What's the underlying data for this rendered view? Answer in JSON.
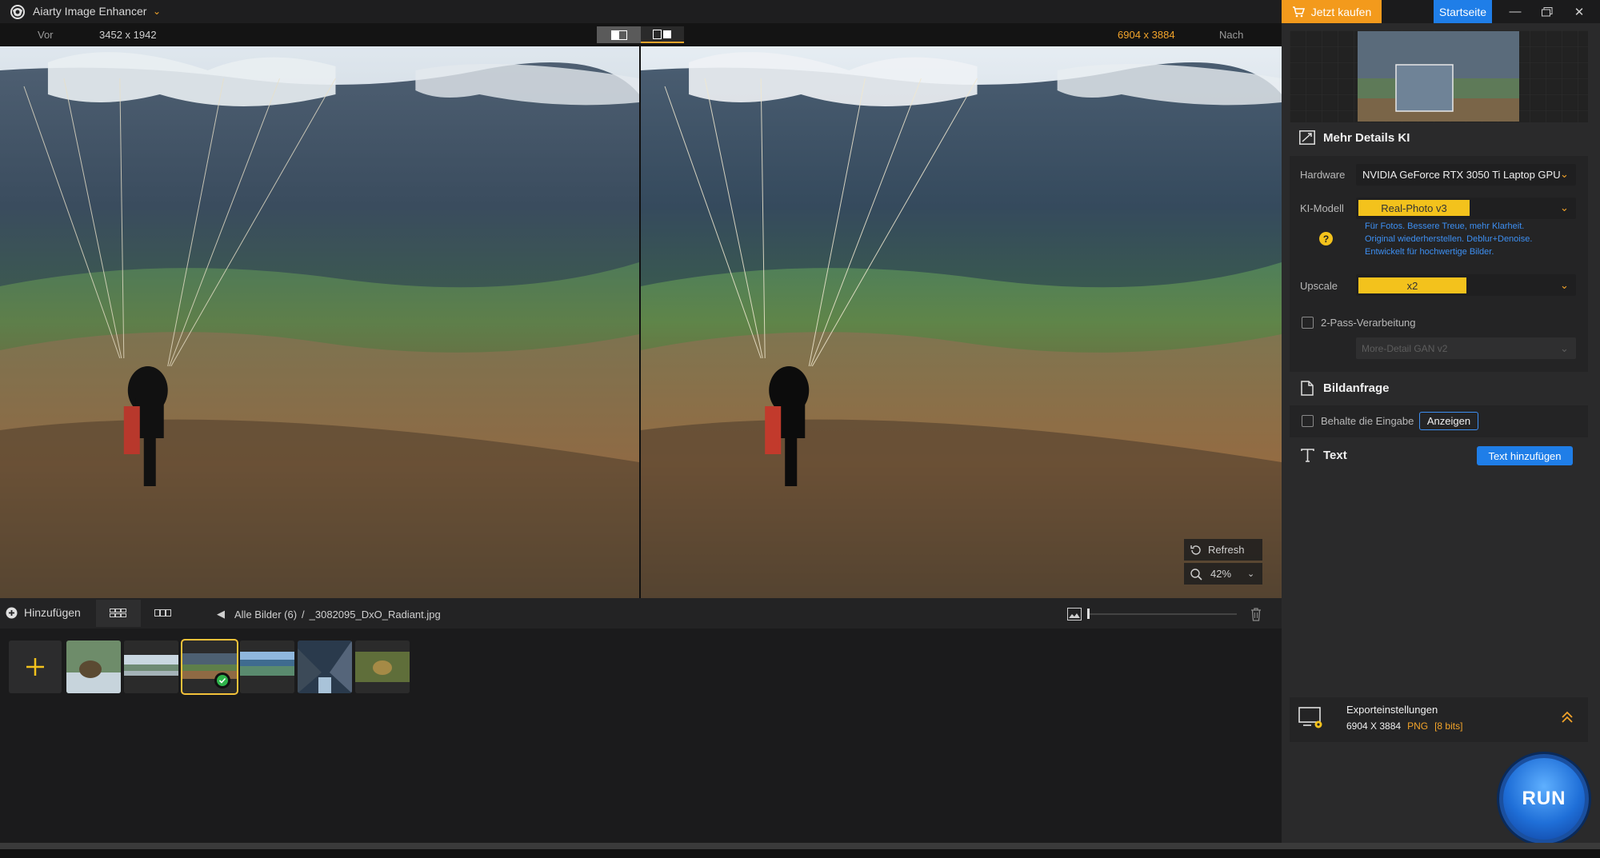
{
  "app": {
    "title": "Aiarty Image Enhancer",
    "buy_label": "Jetzt kaufen",
    "home_label": "Startseite"
  },
  "compare": {
    "before_label": "Vor",
    "before_size": "3452 x 1942",
    "after_size": "6904 x 3884",
    "after_label": "Nach"
  },
  "overlay": {
    "refresh_label": "Refresh",
    "zoom_value": "42%"
  },
  "bottombar": {
    "add_label": "Hinzufügen",
    "breadcrumb_all": "Alle Bilder (6)",
    "breadcrumb_sep": "/",
    "breadcrumb_file": "_3082095_DxO_Radiant.jpg"
  },
  "thumbnails": [
    {
      "name": "thumb-kiwi-bird"
    },
    {
      "name": "thumb-lake-landscape"
    },
    {
      "name": "thumb-paraglider",
      "selected": true
    },
    {
      "name": "thumb-blue-lake"
    },
    {
      "name": "thumb-fjord"
    },
    {
      "name": "thumb-frog"
    }
  ],
  "panel": {
    "ai_section_title": "Mehr Details KI",
    "hardware_label": "Hardware",
    "hardware_value": "NVIDIA GeForce RTX 3050 Ti Laptop GPU",
    "model_label": "KI-Modell",
    "model_value": "Real-Photo v3",
    "model_desc_1": "Für Fotos. Bessere Treue, mehr Klarheit.",
    "model_desc_2": "Original wiederherstellen. Deblur+Denoise.",
    "model_desc_3": "Entwickelt für hochwertige Bilder.",
    "upscale_label": "Upscale",
    "upscale_value": "x2",
    "twopass_label": "2-Pass-Verarbeitung",
    "gan_value": "More-Detail GAN v2",
    "image_section_title": "Bildanfrage",
    "keep_label": "Behalte die Eingabe",
    "show_label": "Anzeigen",
    "text_section_title": "Text",
    "add_text_label": "Text hinzufügen",
    "export_title": "Exporteinstellungen",
    "export_size": "6904 X 3884",
    "export_format": "PNG",
    "export_bits": "[8 bits]",
    "run_label": "RUN"
  },
  "colors": {
    "accent": "#f3a42a",
    "primary_blue": "#1f7ee8",
    "pill_yellow": "#f3c21c"
  }
}
